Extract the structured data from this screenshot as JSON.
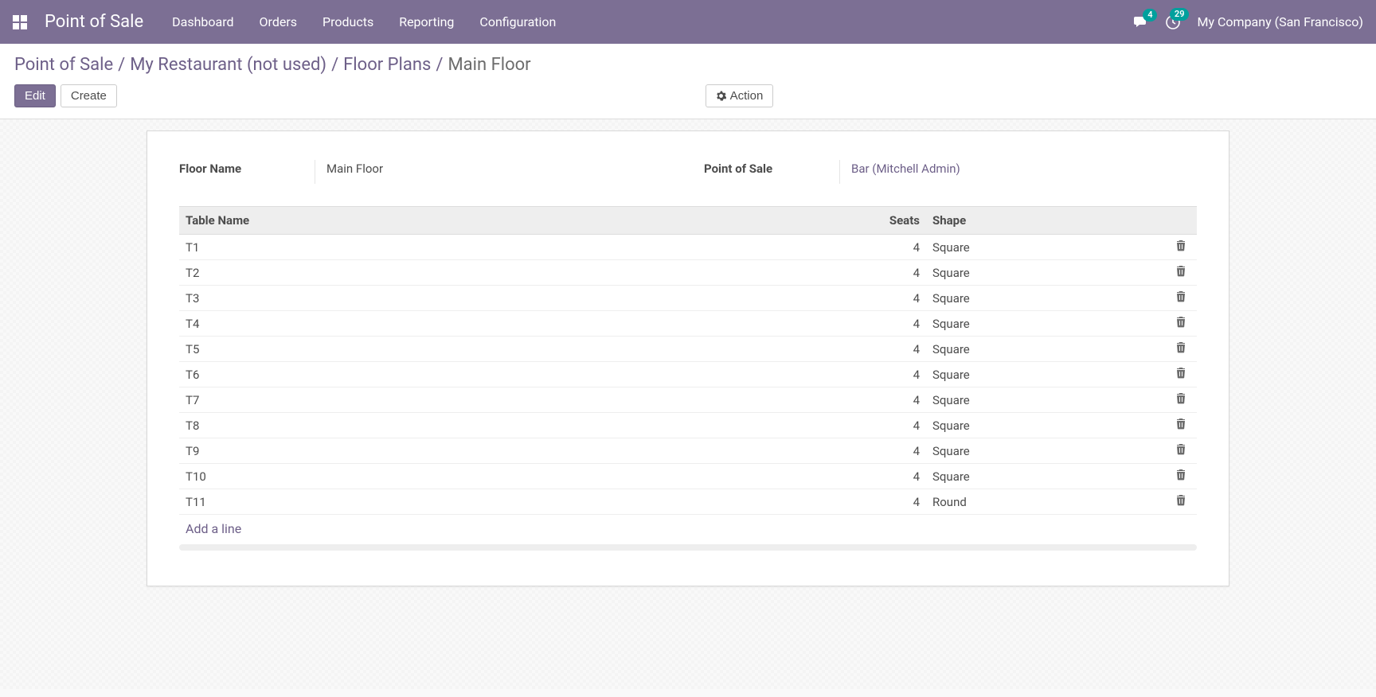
{
  "nav": {
    "brand": "Point of Sale",
    "items": [
      "Dashboard",
      "Orders",
      "Products",
      "Reporting",
      "Configuration"
    ],
    "messages_badge": "4",
    "activities_badge": "29",
    "company": "My Company (San Francisco)"
  },
  "breadcrumb": {
    "parts": [
      "Point of Sale",
      "My Restaurant (not used)",
      "Floor Plans"
    ],
    "current": "Main Floor",
    "sep": "/"
  },
  "buttons": {
    "edit": "Edit",
    "create": "Create",
    "action": "Action"
  },
  "form": {
    "floor_name_label": "Floor Name",
    "floor_name_value": "Main Floor",
    "pos_label": "Point of Sale",
    "pos_value": "Bar (Mitchell Admin)"
  },
  "table": {
    "headers": {
      "name": "Table Name",
      "seats": "Seats",
      "shape": "Shape"
    },
    "rows": [
      {
        "name": "T1",
        "seats": "4",
        "shape": "Square"
      },
      {
        "name": "T2",
        "seats": "4",
        "shape": "Square"
      },
      {
        "name": "T3",
        "seats": "4",
        "shape": "Square"
      },
      {
        "name": "T4",
        "seats": "4",
        "shape": "Square"
      },
      {
        "name": "T5",
        "seats": "4",
        "shape": "Square"
      },
      {
        "name": "T6",
        "seats": "4",
        "shape": "Square"
      },
      {
        "name": "T7",
        "seats": "4",
        "shape": "Square"
      },
      {
        "name": "T8",
        "seats": "4",
        "shape": "Square"
      },
      {
        "name": "T9",
        "seats": "4",
        "shape": "Square"
      },
      {
        "name": "T10",
        "seats": "4",
        "shape": "Square"
      },
      {
        "name": "T11",
        "seats": "4",
        "shape": "Round"
      }
    ],
    "add_line": "Add a line"
  }
}
